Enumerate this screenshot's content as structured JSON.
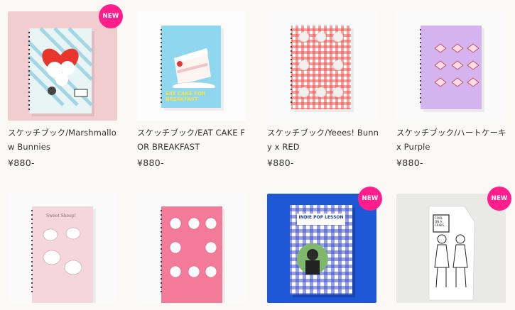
{
  "products": [
    {
      "name": "スケッチブック/Marshmallow Bunnies",
      "price": "¥880-",
      "badge": "NEW"
    },
    {
      "name": "スケッチブック/EAT CAKE FOR BREAKFAST",
      "price": "¥880-",
      "cover_text": "EAT CAKE FOR BREAKFAST"
    },
    {
      "name": "スケッチブック/Yeees! Bunny x RED",
      "price": "¥880-"
    },
    {
      "name": "スケッチブック/ハートケーキ x Purple",
      "price": "¥880-"
    },
    {
      "cover_text": "Sweet Sheep!"
    },
    {},
    {
      "badge": "NEW",
      "cover_text": "INDIE POP LESSON"
    },
    {
      "badge": "NEW",
      "cover_text": "COOL ON A CRISIS"
    }
  ],
  "colors": {
    "badge": "#ff1e8c",
    "background": "#fbf9f6"
  }
}
